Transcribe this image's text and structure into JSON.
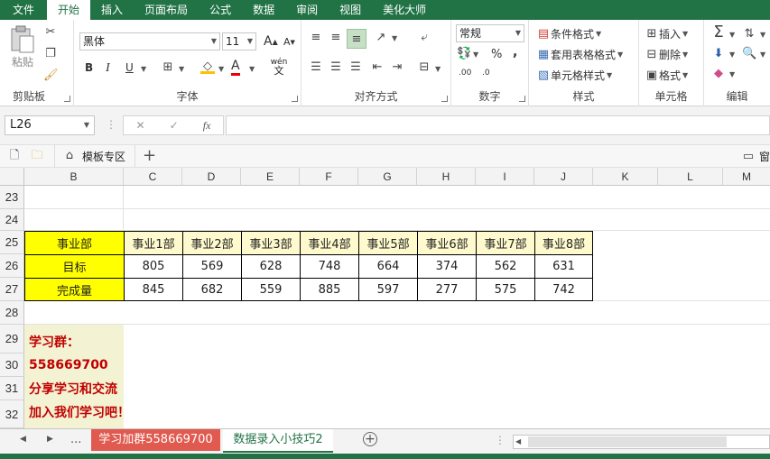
{
  "menu": {
    "tabs": [
      "文件",
      "开始",
      "插入",
      "页面布局",
      "公式",
      "数据",
      "审阅",
      "视图",
      "美化大师"
    ],
    "active": "开始"
  },
  "ribbon": {
    "clipboard": {
      "label": "剪贴板",
      "paste": "粘贴"
    },
    "font": {
      "label": "字体",
      "font_name": "黑体",
      "font_size": "11",
      "bold": "B",
      "italic": "I",
      "underline": "U",
      "grow": "A",
      "shrink": "A",
      "font_color": "A",
      "phonetic_top": "wén",
      "phonetic_bottom": "文"
    },
    "alignment": {
      "label": "对齐方式"
    },
    "number": {
      "label": "数字",
      "format": "常规",
      "percent": "%",
      "comma": ",",
      "inc_decimal": ".00",
      "dec_decimal": ".0"
    },
    "styles": {
      "label": "样式",
      "conditional": "条件格式",
      "table_format": "套用表格格式",
      "cell_styles": "单元格样式"
    },
    "cells": {
      "label": "单元格",
      "insert": "插入",
      "delete": "删除",
      "format": "格式"
    },
    "editing": {
      "label": "编辑"
    }
  },
  "formula_bar": {
    "name_box": "L26",
    "fx": "fx",
    "value": ""
  },
  "doc_tabs": {
    "template": "模板专区",
    "right_label": "窗"
  },
  "columns": [
    "B",
    "C",
    "D",
    "E",
    "F",
    "G",
    "H",
    "I",
    "J",
    "K",
    "L",
    "M"
  ],
  "rows": [
    "23",
    "24",
    "25",
    "26",
    "27",
    "28",
    "29",
    "30",
    "31",
    "32"
  ],
  "table": {
    "header": [
      "事业部",
      "事业1部",
      "事业2部",
      "事业3部",
      "事业4部",
      "事业5部",
      "事业6部",
      "事业7部",
      "事业8部"
    ],
    "target_label": "目标",
    "target": [
      "805",
      "569",
      "628",
      "748",
      "664",
      "374",
      "562",
      "631"
    ],
    "done_label": "完成量",
    "done": [
      "845",
      "682",
      "559",
      "885",
      "597",
      "277",
      "575",
      "742"
    ]
  },
  "notes": [
    "学习群：",
    "558669700",
    "分享学习和交流",
    "加入我们学习吧！"
  ],
  "sheets": {
    "ellipsis": "...",
    "tab1": "学习加群558669700",
    "tab2": "数据录入小技巧2"
  },
  "colors": {
    "excel_green": "#217346",
    "header_yellow": "#ffff00",
    "pale_yellow": "#fffacd",
    "note_bg": "#f3f3d3",
    "note_red": "#c00000",
    "tab_red": "#e05a4f"
  }
}
